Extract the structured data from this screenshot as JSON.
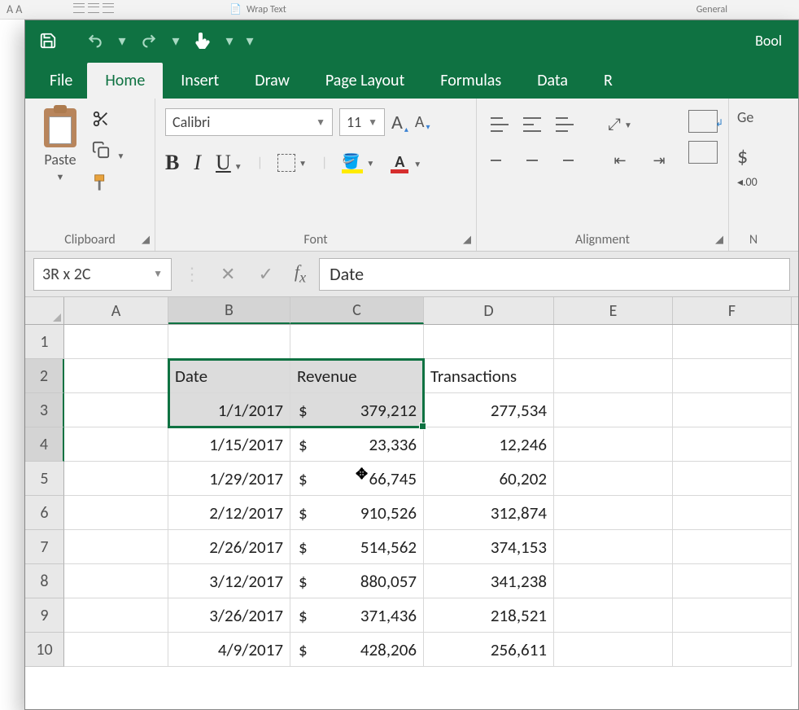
{
  "bg": {
    "wrap": "Wrap Text",
    "general": "General"
  },
  "title": "Bool",
  "tabs": {
    "file": "File",
    "home": "Home",
    "insert": "Insert",
    "draw": "Draw",
    "layout": "Page Layout",
    "formulas": "Formulas",
    "data": "Data",
    "review": "R"
  },
  "groups": {
    "clipboard": "Clipboard",
    "font": "Font",
    "alignment": "Alignment",
    "number_short": "N"
  },
  "paste_label": "Paste",
  "font": {
    "name": "Calibri",
    "size": "11"
  },
  "numberfmt": {
    "label": "Ge"
  },
  "namebox": "3R x 2C",
  "formula": "Date",
  "columns": [
    "A",
    "B",
    "C",
    "D",
    "E",
    "F"
  ],
  "header_row": {
    "b": "Date",
    "c": "Revenue",
    "d": "Transactions"
  },
  "rows": [
    {
      "n": "1"
    },
    {
      "n": "2",
      "header": true
    },
    {
      "n": "3",
      "date": "1/1/2017",
      "rev": "379,212",
      "tx": "277,534"
    },
    {
      "n": "4",
      "date": "1/15/2017",
      "rev": "23,336",
      "tx": "12,246"
    },
    {
      "n": "5",
      "date": "1/29/2017",
      "rev": "66,745",
      "tx": "60,202"
    },
    {
      "n": "6",
      "date": "2/12/2017",
      "rev": "910,526",
      "tx": "312,874"
    },
    {
      "n": "7",
      "date": "2/26/2017",
      "rev": "514,562",
      "tx": "374,153"
    },
    {
      "n": "8",
      "date": "3/12/2017",
      "rev": "880,057",
      "tx": "341,238"
    },
    {
      "n": "9",
      "date": "3/26/2017",
      "rev": "371,436",
      "tx": "218,521"
    },
    {
      "n": "10",
      "date": "4/9/2017",
      "rev": "428,206",
      "tx": "256,611"
    }
  ],
  "dollar": "$"
}
